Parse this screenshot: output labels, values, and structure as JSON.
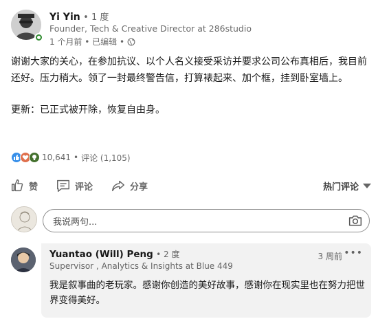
{
  "post": {
    "author": "Yi Yin",
    "degree": "• 1 度",
    "headline": "Founder, Tech & Creative Director at 286studio",
    "meta": "1 个月前 • 已编辑 •",
    "paragraphs": [
      "谢谢大家的关心，在参加抗议、以个人名义接受采访并要求公司公布真相后，我目前还好。压力稍大。领了一封最终警告信，打算裱起来、加个框，挂到卧室墙上。",
      "更新：已正式被开除，恢复自由身。"
    ],
    "reaction_count": "10,641",
    "comments_count": "评论 (1,105)"
  },
  "actions": {
    "like": "赞",
    "comment": "评论",
    "share": "分享",
    "sort": "热门评论"
  },
  "compose": {
    "placeholder": "我说两句..."
  },
  "comment": {
    "author": "Yuantao (Will) Peng",
    "degree": "• 2 度",
    "headline": "Supervisor , Analytics & Insights at Blue 449",
    "time": "3 周前",
    "more": "•••",
    "text": "我是叙事曲的老玩家。感谢你创造的美好故事，感谢你在现实里也在努力把世界变得美好。"
  },
  "colors": {
    "like": "#378fe9",
    "love": "#df704d",
    "insightful": "#44712e",
    "online": "#2f8a2f",
    "comment_bg": "#f2f2f2"
  },
  "icons": [
    "globe-icon",
    "like-icon",
    "comment-icon",
    "share-icon",
    "camera-icon",
    "more-icon",
    "caret-down-icon"
  ]
}
